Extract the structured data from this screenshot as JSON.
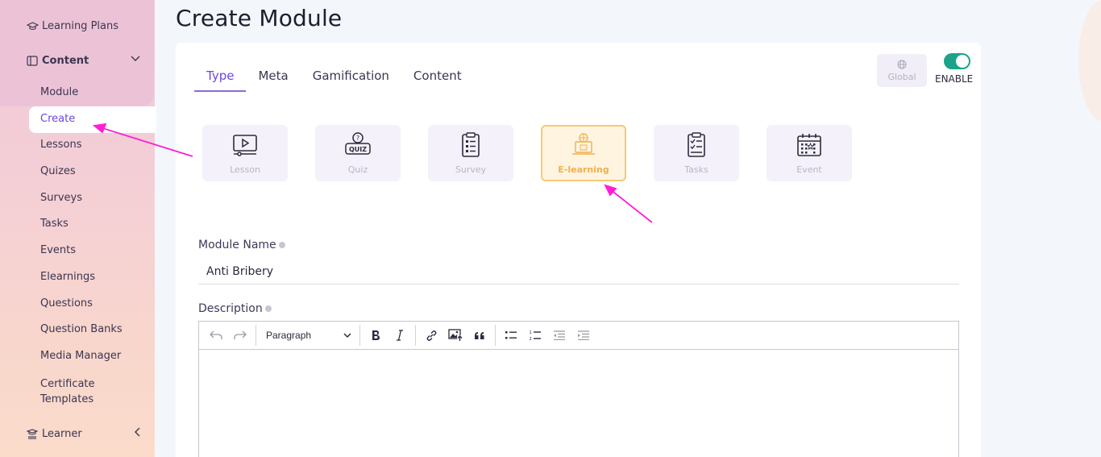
{
  "sidebar": {
    "learning_plans": "Learning Plans",
    "content": "Content",
    "items": [
      {
        "label": "Module"
      },
      {
        "label": "Create"
      },
      {
        "label": "Lessons"
      },
      {
        "label": "Quizes"
      },
      {
        "label": "Surveys"
      },
      {
        "label": "Tasks"
      },
      {
        "label": "Events"
      },
      {
        "label": "Elearnings"
      },
      {
        "label": "Questions"
      },
      {
        "label": "Question Banks"
      },
      {
        "label": "Media Manager"
      },
      {
        "label": "Certificate Templates"
      }
    ],
    "learner": "Learner"
  },
  "page": {
    "title": "Create Module"
  },
  "tabs": [
    {
      "label": "Type"
    },
    {
      "label": "Meta"
    },
    {
      "label": "Gamification"
    },
    {
      "label": "Content"
    }
  ],
  "global_label": "Global",
  "enable_label": "ENABLE",
  "types": [
    {
      "label": "Lesson",
      "icon": "video-lesson-icon"
    },
    {
      "label": "Quiz",
      "icon": "quiz-icon"
    },
    {
      "label": "Survey",
      "icon": "survey-clipboard-icon"
    },
    {
      "label": "E-learning",
      "icon": "elearning-laptop-icon"
    },
    {
      "label": "Tasks",
      "icon": "tasks-clipboard-icon"
    },
    {
      "label": "Event",
      "icon": "calendar-event-icon"
    }
  ],
  "module_name": {
    "label": "Module Name",
    "value": "Anti Bribery"
  },
  "description": {
    "label": "Description",
    "paragraph": "Paragraph"
  },
  "colors": {
    "accent": "#6b46e0",
    "toggle": "#1aa389",
    "selected_border": "#f7c977",
    "arrow": "#ff1dd8"
  }
}
